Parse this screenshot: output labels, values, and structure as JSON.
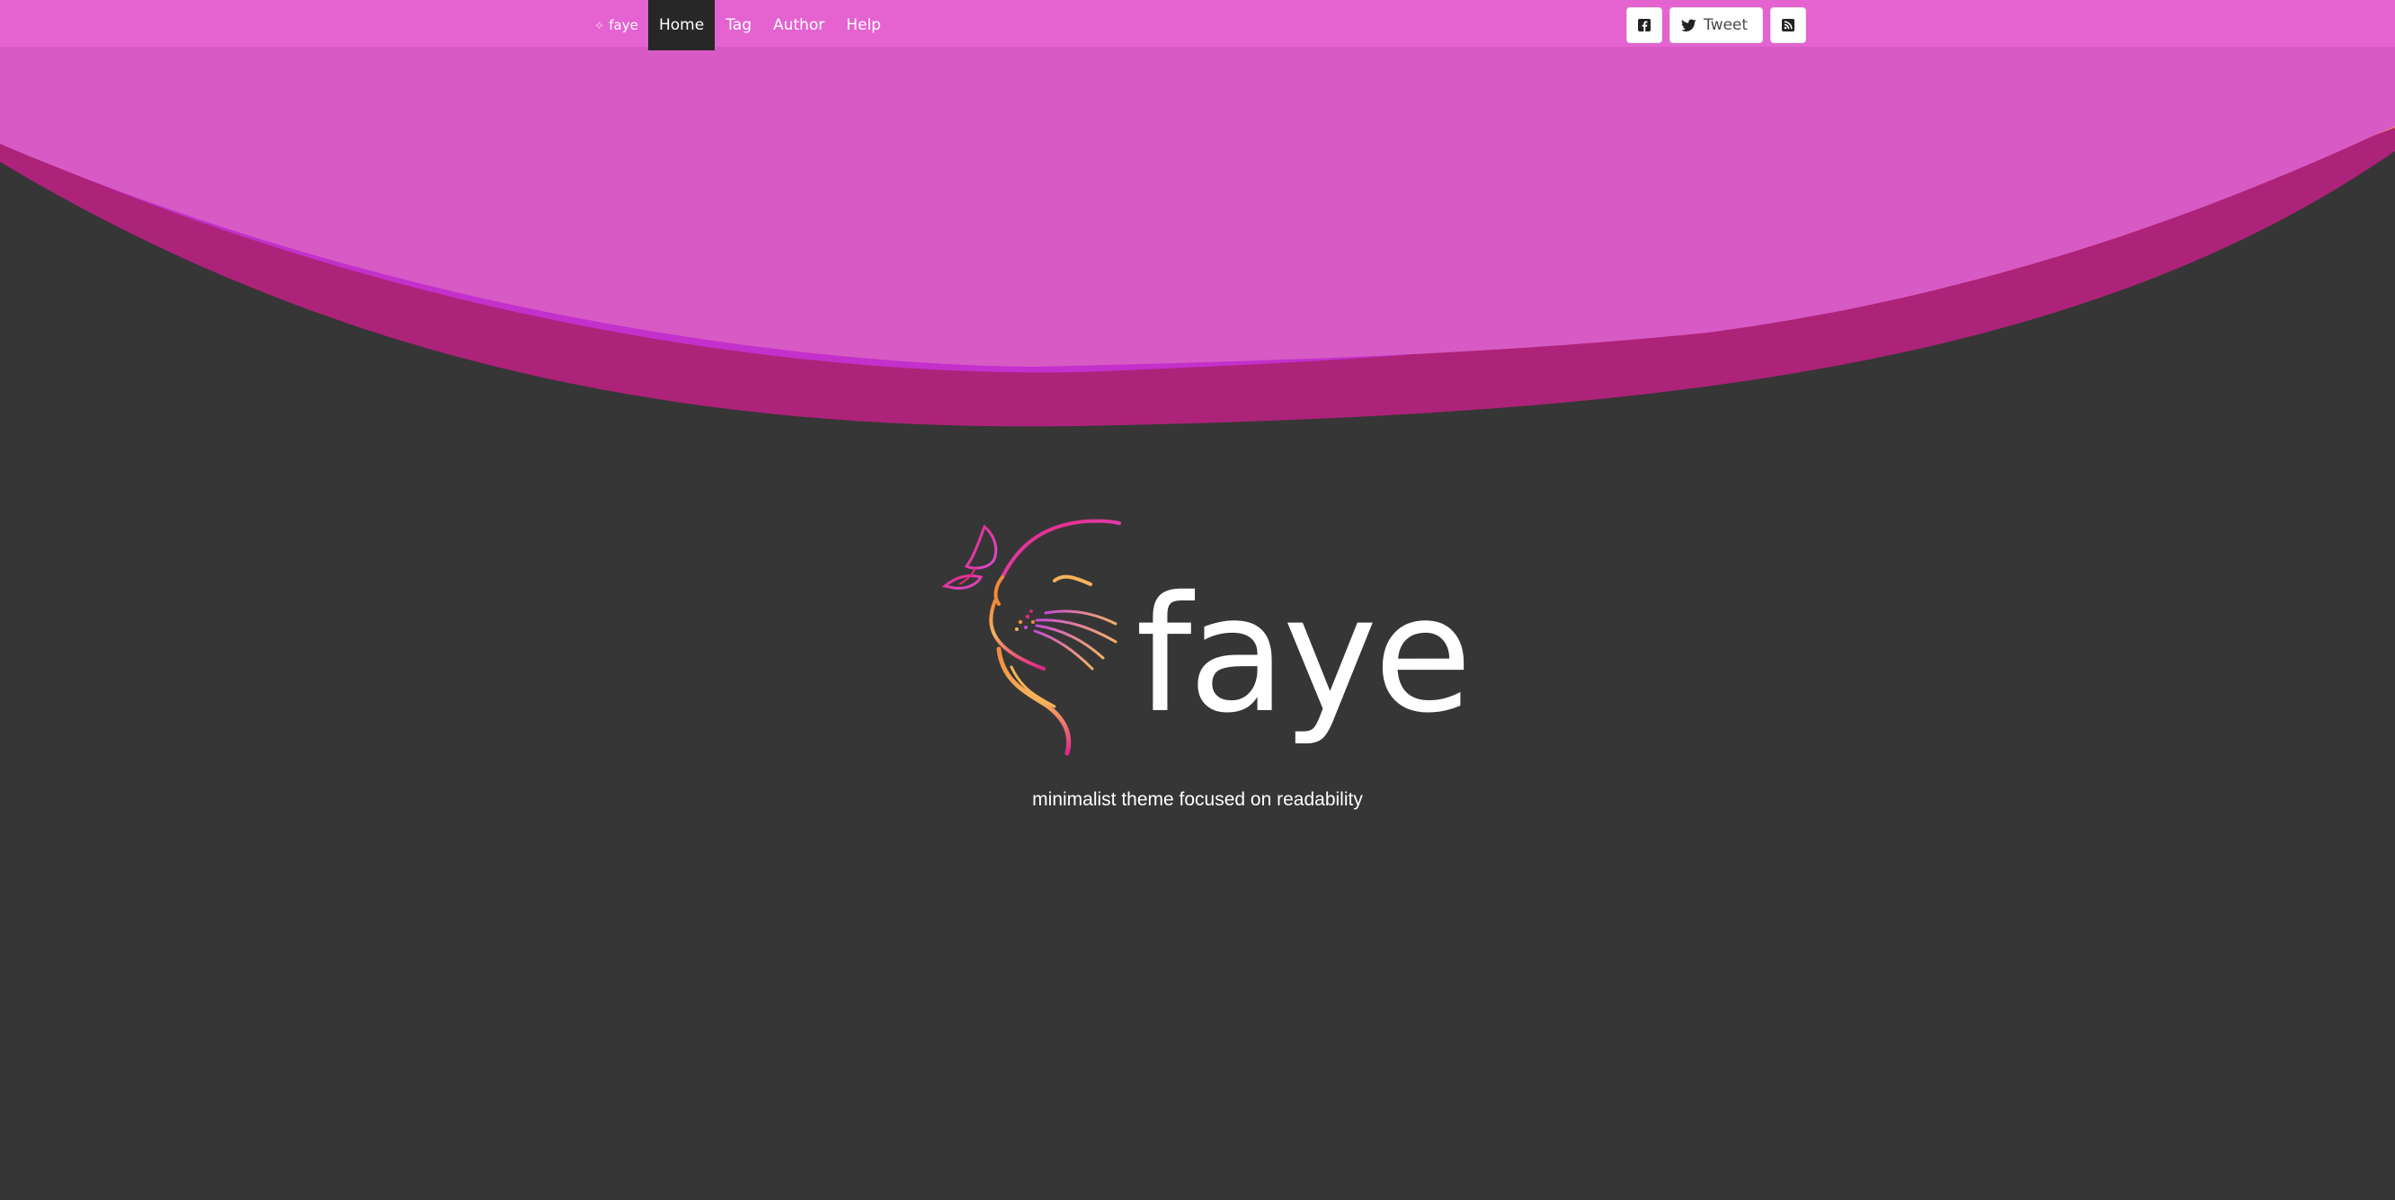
{
  "brand": {
    "name": "faye"
  },
  "nav": {
    "items": [
      {
        "label": "Home",
        "active": true
      },
      {
        "label": "Tag"
      },
      {
        "label": "Author"
      },
      {
        "label": "Help"
      }
    ]
  },
  "share": {
    "facebook_icon": "facebook-square-icon",
    "tweet_label": "Tweet",
    "twitter_icon": "twitter-icon",
    "rss_icon": "rss-square-icon"
  },
  "hero": {
    "logo_text": "faye",
    "tagline": "minimalist theme focused on readability"
  },
  "colors": {
    "navbar": "#e463d1",
    "wave_top": "#d85ac5",
    "wave_violet": "#c330cb",
    "wave_magenta": "#ad2379",
    "wave_orange": "#e38a6b",
    "background": "#363636",
    "active_nav": "#272727"
  }
}
